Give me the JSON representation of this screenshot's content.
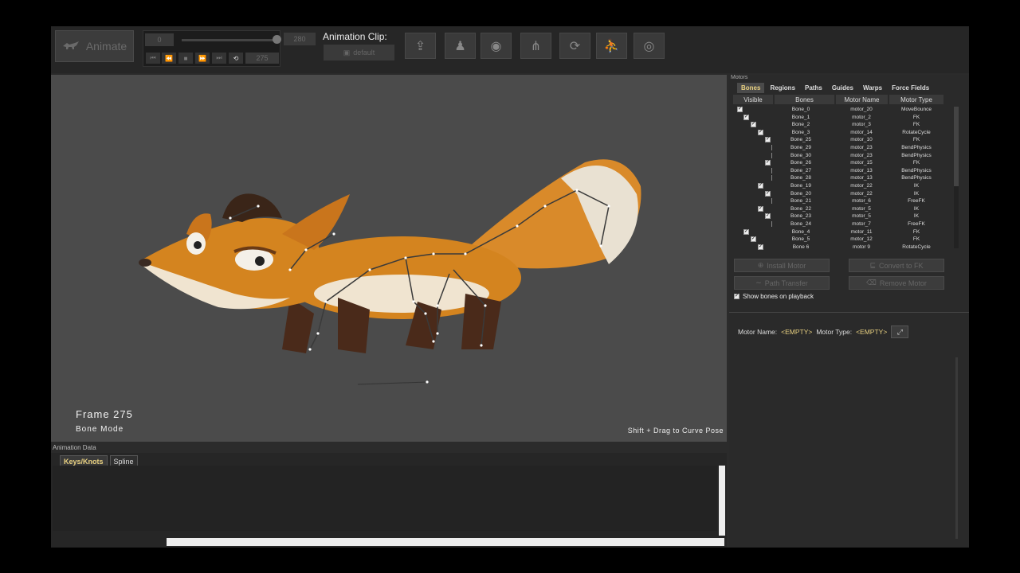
{
  "toolbar": {
    "animate_label": "Animate",
    "start_frame": "0",
    "end_frame": "280",
    "current_frame": "275",
    "clip_label": "Animation Clip:",
    "clip_value": "default",
    "tools": [
      "upload-icon",
      "ghost-icon",
      "camera-icon",
      "hierarchy-icon",
      "loop-icon",
      "runner-icon",
      "physics-icon"
    ]
  },
  "viewport": {
    "frame_text": "Frame 275",
    "mode_text": "Bone Mode",
    "hint_text": "Shift + Drag to Curve Pose"
  },
  "animation_data": {
    "title": "Animation Data",
    "tabs": [
      "Keys/Knots",
      "Spline"
    ]
  },
  "motors": {
    "title": "Motors",
    "tabs": [
      "Bones",
      "Regions",
      "Paths",
      "Guides",
      "Warps",
      "Force Fields"
    ],
    "columns": [
      "Visible",
      "Bones",
      "Motor Name",
      "Motor Type"
    ],
    "rows": [
      {
        "bone": "Bone_0",
        "motor": "motor_20",
        "type": "MoveBounce",
        "checked": true
      },
      {
        "bone": "Bone_1",
        "motor": "motor_2",
        "type": "FK",
        "checked": true
      },
      {
        "bone": "Bone_2",
        "motor": "motor_3",
        "type": "FK",
        "checked": true
      },
      {
        "bone": "Bone_3",
        "motor": "motor_14",
        "type": "RotateCycle",
        "checked": true
      },
      {
        "bone": "Bone_25",
        "motor": "motor_10",
        "type": "FK",
        "checked": true
      },
      {
        "bone": "Bone_29",
        "motor": "motor_23",
        "type": "BendPhysics",
        "checked": false
      },
      {
        "bone": "Bone_30",
        "motor": "motor_23",
        "type": "BendPhysics",
        "checked": false
      },
      {
        "bone": "Bone_26",
        "motor": "motor_15",
        "type": "FK",
        "checked": true
      },
      {
        "bone": "Bone_27",
        "motor": "motor_13",
        "type": "BendPhysics",
        "checked": false
      },
      {
        "bone": "Bone_28",
        "motor": "motor_13",
        "type": "BendPhysics",
        "checked": false
      },
      {
        "bone": "Bone_19",
        "motor": "motor_22",
        "type": "IK",
        "checked": true
      },
      {
        "bone": "Bone_20",
        "motor": "motor_22",
        "type": "IK",
        "checked": true
      },
      {
        "bone": "Bone_21",
        "motor": "motor_6",
        "type": "FreeFK",
        "checked": false
      },
      {
        "bone": "Bone_22",
        "motor": "motor_5",
        "type": "IK",
        "checked": true
      },
      {
        "bone": "Bone_23",
        "motor": "motor_5",
        "type": "IK",
        "checked": true
      },
      {
        "bone": "Bone_24",
        "motor": "motor_7",
        "type": "FreeFK",
        "checked": false
      },
      {
        "bone": "Bone_4",
        "motor": "motor_11",
        "type": "FK",
        "checked": true
      },
      {
        "bone": "Bone_5",
        "motor": "motor_12",
        "type": "FK",
        "checked": true
      },
      {
        "bone": "Bone 6",
        "motor": "motor 9",
        "type": "RotateCycle",
        "checked": true
      }
    ],
    "buttons": {
      "install": "Install Motor",
      "convert": "Convert to FK",
      "path_transfer": "Path Transfer",
      "remove": "Remove Motor"
    },
    "show_bones_label": "Show bones on playback",
    "motor_name_label": "Motor Name:",
    "motor_name_value": "<EMPTY>",
    "motor_type_label": "Motor Type:",
    "motor_type_value": "<EMPTY>"
  }
}
